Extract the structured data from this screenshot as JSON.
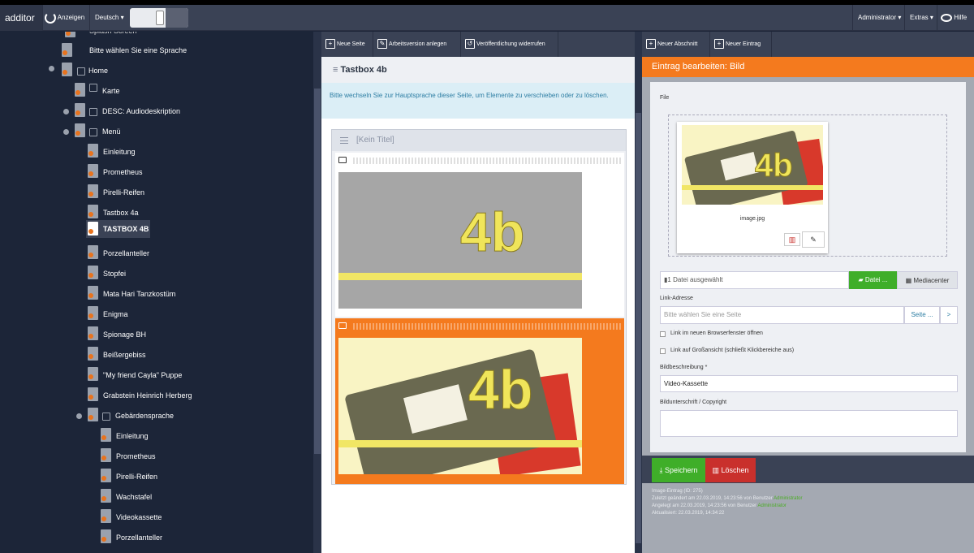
{
  "topbar": {
    "brand": "additor",
    "view_label": "Anzeigen",
    "language": "Deutsch",
    "user": "Administrator",
    "extras": "Extras",
    "help": "Hilfe"
  },
  "tree": {
    "top_partial": "Splash Screen",
    "choose_language": "Bitte wählen Sie eine Sprache",
    "items": [
      {
        "label": "Home"
      },
      {
        "label": "Karte"
      },
      {
        "label": "DESC: Audiodeskription"
      },
      {
        "label": "Menü"
      },
      {
        "label": "Einleitung"
      },
      {
        "label": "Prometheus"
      },
      {
        "label": "Pirelli-Reifen"
      },
      {
        "label": "Tastbox 4a"
      },
      {
        "label": "TASTBOX 4B"
      },
      {
        "label": "Porzellanteller"
      },
      {
        "label": "Stopfei"
      },
      {
        "label": "Mata Hari Tanzkostüm"
      },
      {
        "label": "Enigma"
      },
      {
        "label": "Spionage BH"
      },
      {
        "label": "Beißergebiss"
      },
      {
        "label": "\"My friend Cayla\" Puppe"
      },
      {
        "label": "Grabstein Heinrich Herberg"
      },
      {
        "label": "Gebärdensprache"
      },
      {
        "label": "Einleitung"
      },
      {
        "label": "Prometheus"
      },
      {
        "label": "Pirelli-Reifen"
      },
      {
        "label": "Wachstafel"
      },
      {
        "label": "Videokassette"
      },
      {
        "label": "Porzellanteller"
      }
    ]
  },
  "middle": {
    "toolbar": {
      "new_page": "Neue Seite",
      "work_version": "Arbeitsversion anlegen",
      "unpublish": "Veröffentlichung widerrufen"
    },
    "page_title": "Tastbox 4b",
    "info": "Bitte wechseln Sie zur Hauptsprache dieser Seite, um Elemente zu verschieben oder zu löschen.",
    "box_title": "[Kein Titel]",
    "image_text": "4b"
  },
  "right": {
    "toolbar": {
      "new_section": "Neuer Abschnitt",
      "new_entry": "Neuer Eintrag"
    },
    "header": "Eintrag bearbeiten: Bild",
    "file_label": "File",
    "filename": "image.jpg",
    "file_selected": "1 Datei ausgewählt",
    "file_button": "Datei ...",
    "mediacenter_button": "Mediacenter",
    "link_label": "Link-Adresse",
    "link_placeholder": "Bitte wählen Sie eine Seite",
    "page_button": "Seite ...",
    "page_arrow": ">",
    "check_new_window": "Link im neuen Browserfenster öffnen",
    "check_large_view": "Link auf Großansicht (schließt Klickbereiche aus)",
    "desc_label": "Bildbeschreibung *",
    "desc_value": "Video-Kassette",
    "caption_label": "Bildunterschrift / Copyright",
    "caption_value": "",
    "save": "Speichern",
    "delete": "Löschen",
    "meta": {
      "line1": "Image-Eintrag (ID: 275)",
      "line2_prefix": "Zuletzt geändert am 22.03.2019, 14:23:56 von Benutzer ",
      "line2_user": "Administrator",
      "line3_prefix": "Angelegt am 22.03.2019, 14:23:56 von Benutzer ",
      "line3_user": "Administrator",
      "line4": "Aktualisiert: 22.03.2019, 14:34:22"
    }
  },
  "colors": {
    "accent": "#f47a1e",
    "save": "#3fae29",
    "delete": "#c9302c",
    "nav": "#3a4255"
  }
}
